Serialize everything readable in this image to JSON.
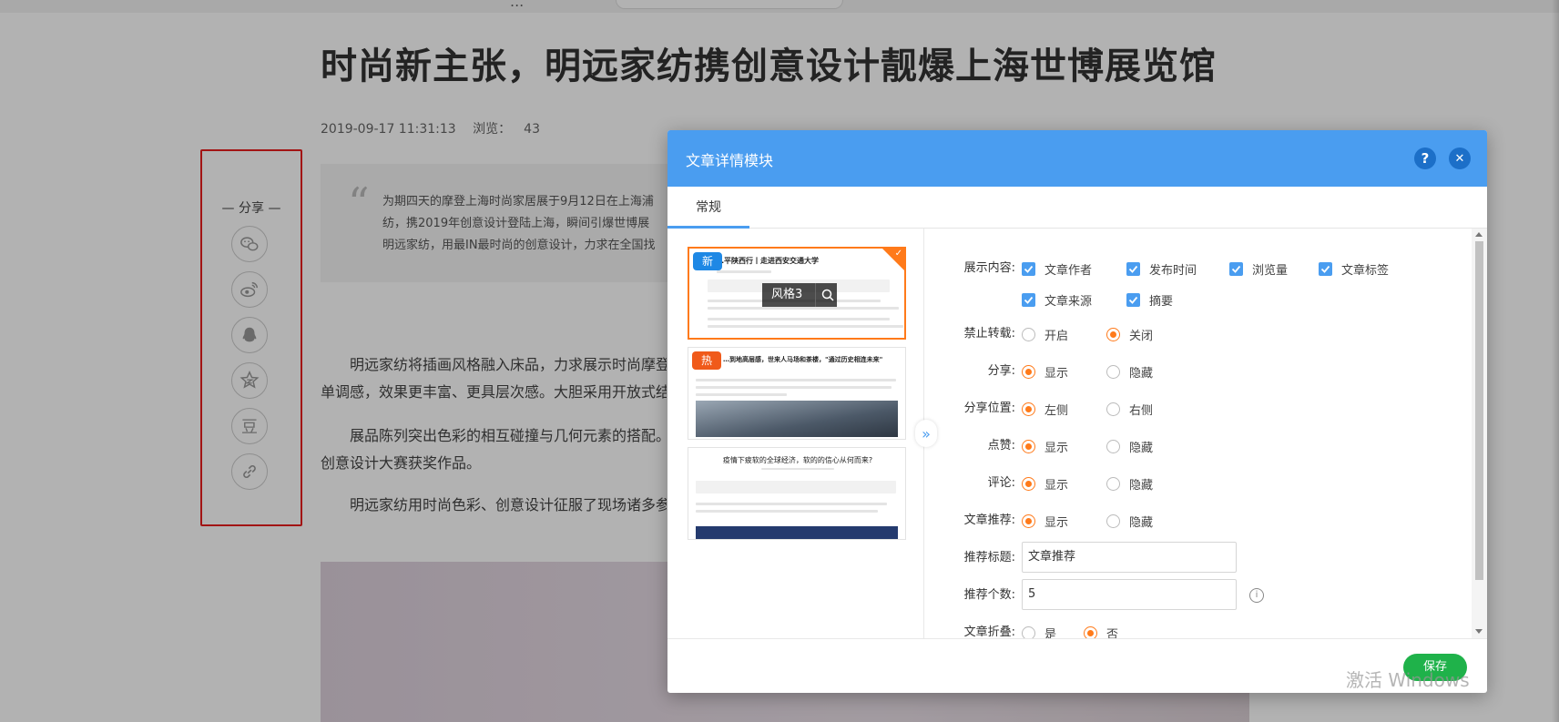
{
  "background_article": {
    "top_strip_text": "...",
    "title": "时尚新主张，明远家纺携创意设计靓爆上海世博展览馆",
    "date": "2019-09-17 11:31:13",
    "views_label": "浏览：",
    "views": "43",
    "quote_lines": [
      "为期四天的摩登上海时尚家居展于9月12日在上海浦",
      "纺，携2019年创意设计登陆上海，瞬间引爆世博展",
      "明远家纺，用最IN最时尚的创意设计，力求在全国找"
    ],
    "paragraphs": [
      [
        "明远家纺将插画风格融入床品，力求展示时尚摩登",
        "单调感，效果更丰富、更具层次感。大胆采用开放式结"
      ],
      [
        "展品陈列突出色彩的相互碰撞与几何元素的搭配。",
        "创意设计大赛获奖作品。"
      ],
      [
        "明远家纺用时尚色彩、创意设计征服了现场诸多参"
      ]
    ]
  },
  "share_rail": {
    "title": "— 分享 —",
    "buttons": [
      {
        "icon": "wechat-icon"
      },
      {
        "icon": "weibo-icon"
      },
      {
        "icon": "qq-icon"
      },
      {
        "icon": "qzone-icon"
      },
      {
        "icon": "douban-icon",
        "glyph": "豆"
      },
      {
        "icon": "link-icon"
      }
    ]
  },
  "dialog": {
    "title": "文章详情模块",
    "help_glyph": "?",
    "close_glyph": "✕",
    "tab": "常规",
    "styles": [
      {
        "badge": "新",
        "title": "…平陕西行丨走进西安交通大学",
        "label": "风格3",
        "selected": true
      },
      {
        "badge": "热",
        "title": "…到地高层感，世来人马场和茶楼，\"通过历史相连未来\"",
        "selected": false
      },
      {
        "badge": "",
        "title": "疫情下疲软的全球经济，软的的信心从何而来?",
        "selected": false
      }
    ],
    "collapse_glyph": "»",
    "form": {
      "display_label": "展示内容:",
      "display_options": [
        "文章作者",
        "发布时间",
        "浏览量",
        "文章标签",
        "文章来源",
        "摘要"
      ],
      "rows": [
        {
          "label": "禁止转载:",
          "options": [
            "开启",
            "关闭"
          ],
          "selected": 1
        },
        {
          "label": "分享:",
          "options": [
            "显示",
            "隐藏"
          ],
          "selected": 0
        },
        {
          "label": "分享位置:",
          "options": [
            "左侧",
            "右侧"
          ],
          "selected": 0
        },
        {
          "label": "点赞:",
          "options": [
            "显示",
            "隐藏"
          ],
          "selected": 0
        },
        {
          "label": "评论:",
          "options": [
            "显示",
            "隐藏"
          ],
          "selected": 0
        },
        {
          "label": "文章推荐:",
          "options": [
            "显示",
            "隐藏"
          ],
          "selected": 0
        }
      ],
      "rec_title_label": "推荐标题:",
      "rec_title_value": "文章推荐",
      "rec_count_label": "推荐个数:",
      "rec_count_value": "5",
      "info_glyph": "i",
      "fold_label": "文章折叠:",
      "fold_options": [
        "是",
        "否"
      ],
      "fold_selected": 1
    },
    "save_label": "保存"
  },
  "watermark": "激活 Windows",
  "colors": {
    "accent": "#4a9df0",
    "selected": "#ff7a1a",
    "save": "#1fb24a",
    "share_highlight": "#e81e1e"
  }
}
